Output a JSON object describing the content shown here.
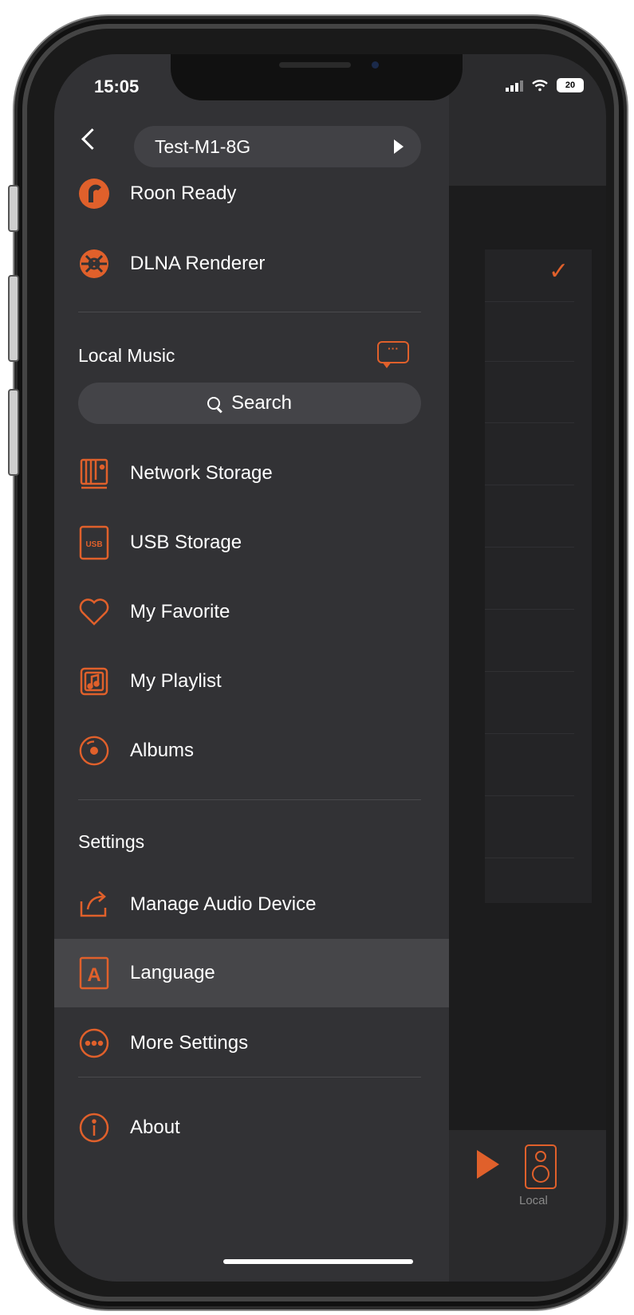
{
  "status_bar": {
    "time": "15:05",
    "battery": "20"
  },
  "header": {
    "device_name": "Test-M1-8G"
  },
  "sources": [
    {
      "label": "Roon Ready",
      "icon": "roon-icon"
    },
    {
      "label": "DLNA Renderer",
      "icon": "dlna-icon"
    }
  ],
  "local_music": {
    "title": "Local Music",
    "search_label": "Search",
    "items": [
      {
        "label": "Network Storage",
        "icon": "network-storage-icon"
      },
      {
        "label": "USB Storage",
        "icon": "usb-storage-icon",
        "icon_text": "USB"
      },
      {
        "label": "My Favorite",
        "icon": "heart-icon"
      },
      {
        "label": "My Playlist",
        "icon": "playlist-icon"
      },
      {
        "label": "Albums",
        "icon": "album-disc-icon"
      }
    ]
  },
  "settings": {
    "title": "Settings",
    "items": [
      {
        "label": "Manage Audio Device",
        "icon": "share-device-icon"
      },
      {
        "label": "Language",
        "icon": "language-icon",
        "icon_text": "A"
      },
      {
        "label": "More Settings",
        "icon": "more-icon"
      }
    ]
  },
  "about": {
    "label": "About"
  },
  "background": {
    "bottom_label": "Local"
  },
  "colors": {
    "accent": "#e0602b",
    "drawer": "#323235",
    "highlight": "#464649"
  }
}
